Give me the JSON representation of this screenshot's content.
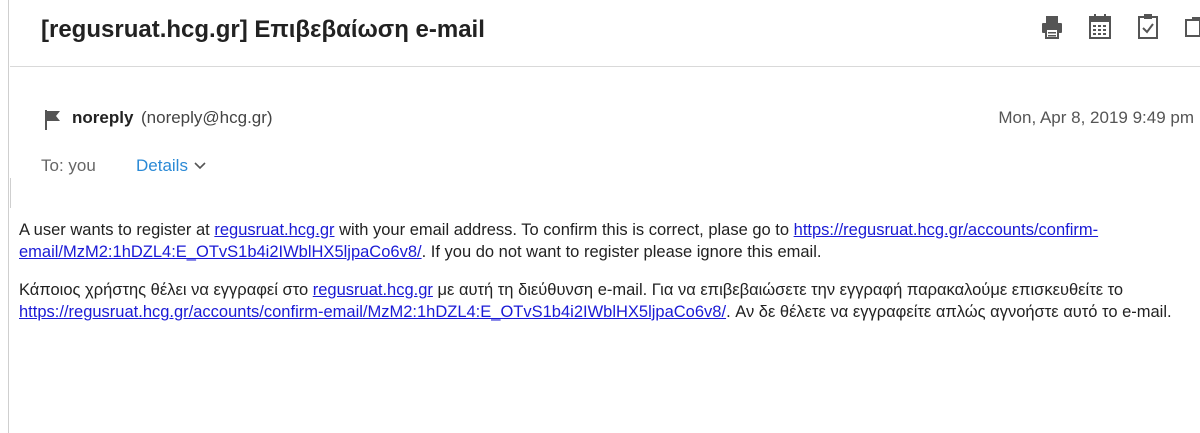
{
  "email": {
    "subject": "[regusruat.hcg.gr] Επιβεβαίωση e-mail",
    "sender": {
      "name": "noreply",
      "address": "(noreply@hcg.gr)"
    },
    "date": "Mon, Apr 8, 2019 9:49 pm",
    "to_label": "To: you",
    "details_label": "Details",
    "body": {
      "en": {
        "text1": "A user wants to register at ",
        "link1": "regusruat.hcg.gr",
        "text2": " with your email address. To confirm this is correct, plase go to ",
        "link2": "https://regusruat.hcg.gr/accounts/confirm-email/MzM2:1hDZL4:E_OTvS1b4i2IWblHX5ljpaCo6v8/",
        "text3": ". If you do not want to register please ignore this email."
      },
      "el": {
        "text1": "Κάποιος χρήστης θέλει να εγγραφεί στο ",
        "link1": "regusruat.hcg.gr",
        "text2": " με αυτή τη διεύθυνση e-mail. Για να επιβεβαιώσετε την εγγραφή παρακαλούμε επισκευθείτε το ",
        "link2": "https://regusruat.hcg.gr/accounts/confirm-email/MzM2:1hDZL4:E_OTvS1b4i2IWblHX5ljpaCo6v8/",
        "text3": ". Αν δε θέλετε να εγγραφείτε απλώς αγνοήστε αυτό το e-mail."
      }
    }
  },
  "toolbar": {
    "icons": [
      "print-icon",
      "calendar-icon",
      "clipboard-check-icon",
      "popout-icon"
    ]
  },
  "colors": {
    "link": "#1a1ad6",
    "details": "#2b8ad6",
    "icon": "#555555"
  }
}
